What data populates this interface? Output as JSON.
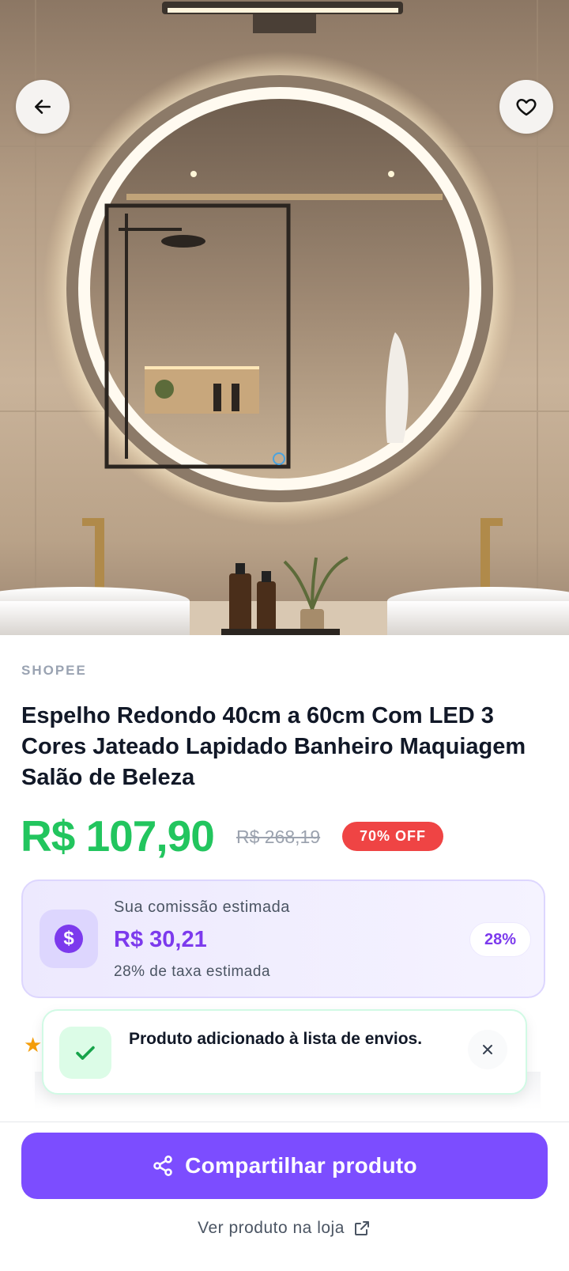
{
  "header": {
    "back_icon": "arrow-left-icon",
    "favorite_icon": "heart-icon"
  },
  "product": {
    "store": "SHOPEE",
    "title": "Espelho Redondo 40cm a 60cm Com LED 3 Cores Jateado Lapidado Banheiro Maquiagem Salão de Beleza",
    "price": "R$ 107,90",
    "old_price": "R$ 268,19",
    "discount": "70% OFF",
    "image_alt": "Round LED bathroom mirror"
  },
  "commission": {
    "label": "Sua comissão estimada",
    "value": "R$ 30,21",
    "rate_text": "28% de taxa estimada",
    "percent": "28%",
    "icon": "dollar-icon"
  },
  "rating": {
    "icon": "star-icon"
  },
  "toast": {
    "message": "Produto adicionado à lista de envios.",
    "icon": "check-icon",
    "close_icon": "close-icon"
  },
  "actions": {
    "share_label": "Compartilhar produto",
    "share_icon": "share-icon",
    "view_store_label": "Ver produto na loja",
    "external_icon": "external-link-icon"
  },
  "colors": {
    "price_green": "#22c55e",
    "accent_purple": "#7c4dff",
    "discount_red": "#ef4444"
  }
}
